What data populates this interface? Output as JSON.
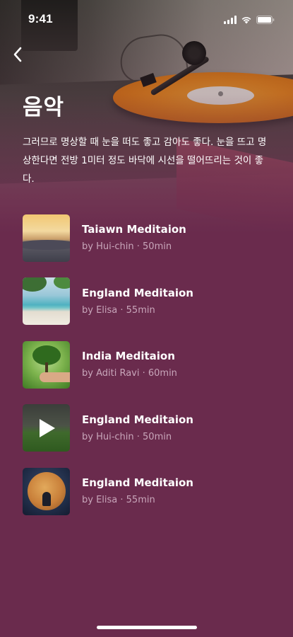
{
  "status_bar": {
    "time": "9:41",
    "icons": [
      "signal-icon",
      "wifi-icon",
      "battery-icon"
    ]
  },
  "header": {
    "back_icon": "chevron-left-icon",
    "title": "음악",
    "description": "그러므로 명상할 때 눈을 떠도 좋고 감아도 좋다. 눈을 뜨고 명상한다면 전방 1미터 정도 바닥에 시선을 떨어뜨리는 것이 좋다."
  },
  "tracks": [
    {
      "title": "Taiawn Meditaion",
      "meta": "by Hui-chin · 50min",
      "thumbnail": "mountain-sunset"
    },
    {
      "title": "England Meditaion",
      "meta": "by Elisa · 55min",
      "thumbnail": "beach"
    },
    {
      "title": "India Meditaion",
      "meta": "by Aditi Ravi · 60min",
      "thumbnail": "tree-in-hand"
    },
    {
      "title": "England Meditaion",
      "meta": "by Hui-chin · 50min",
      "thumbnail": "field-video"
    },
    {
      "title": "England Meditaion",
      "meta": "by Elisa · 55min",
      "thumbnail": "moon-figure"
    }
  ],
  "colors": {
    "background": "#6a2b4d",
    "meta_text": "#c8a6ba",
    "record_orange": "#ed8a1e"
  }
}
